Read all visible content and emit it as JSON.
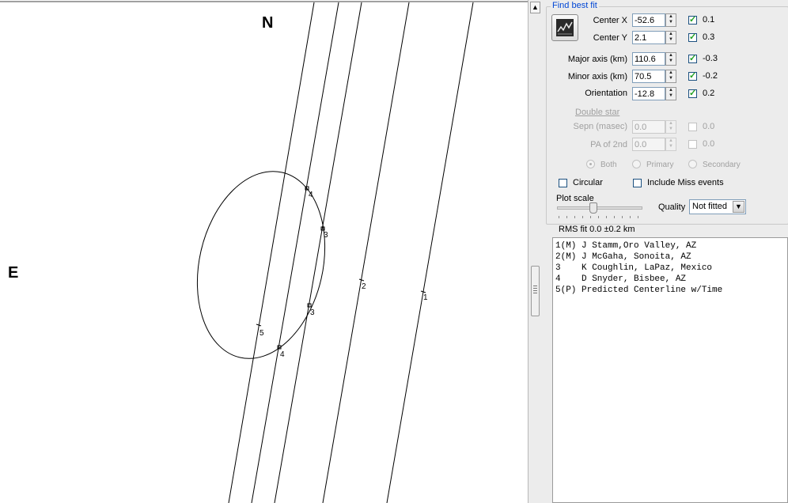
{
  "plot": {
    "north_label": "N",
    "east_label": "E",
    "chord_labels": [
      "1",
      "2",
      "3",
      "3",
      "4",
      "4",
      "5"
    ]
  },
  "panel": {
    "group_title": "Find best fit",
    "fit_button_icon": "fit-chart-icon",
    "params": [
      {
        "label": "Center X",
        "value": "-52.6",
        "checked": true,
        "result": "0.1",
        "enabled": true
      },
      {
        "label": "Center Y",
        "value": "2.1",
        "checked": true,
        "result": "0.3",
        "enabled": true
      },
      {
        "label": "Major axis (km)",
        "value": "110.6",
        "checked": true,
        "result": "-0.3",
        "enabled": true
      },
      {
        "label": "Minor axis (km)",
        "value": "70.5",
        "checked": true,
        "result": "-0.2",
        "enabled": true
      },
      {
        "label": "Orientation",
        "value": "-12.8",
        "checked": true,
        "result": "0.2",
        "enabled": true
      }
    ],
    "double_star": {
      "title": "Double star",
      "params": [
        {
          "label": "Sepn (masec)",
          "value": "0.0",
          "checked": false,
          "result": "0.0",
          "enabled": false
        },
        {
          "label": "PA of 2nd",
          "value": "0.0",
          "checked": false,
          "result": "0.0",
          "enabled": false
        }
      ],
      "radios": [
        {
          "label": "Both",
          "selected": true
        },
        {
          "label": "Primary",
          "selected": false
        },
        {
          "label": "Secondary",
          "selected": false
        }
      ]
    },
    "circular_label": "Circular",
    "circular_checked": false,
    "include_miss_label": "Include Miss events",
    "include_miss_checked": false,
    "plot_scale_label": "Plot scale",
    "plot_scale_value": 0.43,
    "quality_label": "Quality",
    "quality_value": "Not fitted",
    "rms_text": "RMS fit 0.0 ±0.2 km",
    "observers": [
      "1(M) J Stamm,Oro Valley, AZ",
      "2(M) J McGaha, Sonoita, AZ",
      "3    K Coughlin, LaPaz, Mexico",
      "4    D Snyder, Bisbee, AZ",
      "5(P) Predicted Centerline w/Time"
    ]
  }
}
